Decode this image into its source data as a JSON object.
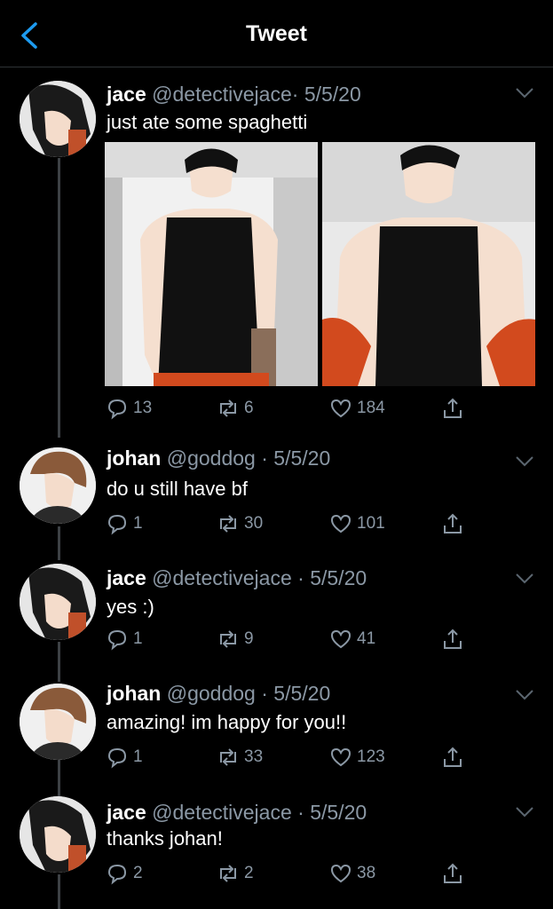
{
  "header": {
    "title": "Tweet"
  },
  "tweets": [
    {
      "name": "jace",
      "handle": "@detectivejace",
      "date": "· 5/5/20",
      "text": "just ate some spaghetti",
      "replies": "13",
      "retweets": "6",
      "likes": "184"
    },
    {
      "name": "johan",
      "handle": "@goddog",
      "date": "· 5/5/20",
      "text": "do u still have bf",
      "replies": "1",
      "retweets": "30",
      "likes": "101"
    },
    {
      "name": "jace",
      "handle": "@detectivejace",
      "date": "· 5/5/20",
      "text": "yes :)",
      "replies": "1",
      "retweets": "9",
      "likes": "41"
    },
    {
      "name": "johan",
      "handle": "@goddog",
      "date": "· 5/5/20",
      "text": "amazing! im happy for you!!",
      "replies": "1",
      "retweets": "33",
      "likes": "123"
    },
    {
      "name": "jace",
      "handle": "@detectivejace",
      "date": "· 5/5/20",
      "text": "thanks johan!",
      "replies": "2",
      "retweets": "2",
      "likes": "38"
    }
  ],
  "colors": {
    "background": "#000000",
    "secondary_text": "#8b98a5",
    "accent": "#1d9bf0"
  }
}
